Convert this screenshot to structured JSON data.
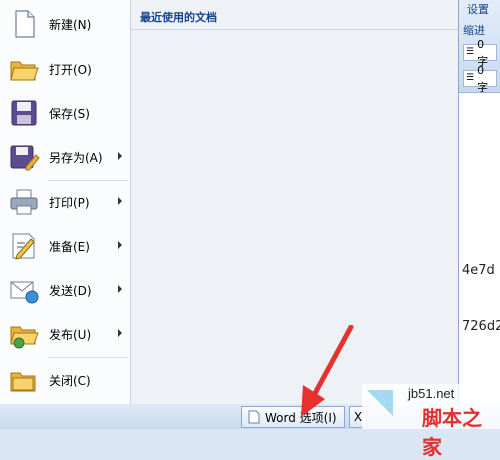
{
  "office_menu": {
    "items": [
      {
        "label": "新建(N)",
        "icon": "new-document-icon",
        "submenu": false
      },
      {
        "label": "打开(O)",
        "icon": "open-folder-icon",
        "submenu": false
      },
      {
        "label": "保存(S)",
        "icon": "save-disk-icon",
        "submenu": false
      },
      {
        "label": "另存为(A)",
        "icon": "save-as-icon",
        "submenu": true
      },
      {
        "label": "打印(P)",
        "icon": "printer-icon",
        "submenu": true
      },
      {
        "label": "准备(E)",
        "icon": "prepare-icon",
        "submenu": true
      },
      {
        "label": "发送(D)",
        "icon": "send-icon",
        "submenu": true
      },
      {
        "label": "发布(U)",
        "icon": "publish-icon",
        "submenu": true
      },
      {
        "label": "关闭(C)",
        "icon": "close-folder-icon",
        "submenu": false
      }
    ]
  },
  "recent_documents": {
    "title": "最近使用的文档"
  },
  "bottom_bar": {
    "word_options_label": "Word 选项(I)",
    "exit_label": "X"
  },
  "background_document": {
    "ribbon_text_1": "设置",
    "ribbon_text_2": "缩进",
    "field_1": "0 字",
    "field_2": "0 字",
    "text_fragment_1": "4e7d",
    "text_fragment_2": "726d2"
  },
  "watermark": {
    "url": "jb51.net",
    "text": "脚本之家"
  },
  "colors": {
    "accent": "#15428b",
    "arrow": "#e8312f",
    "watermark": "#e23030"
  }
}
